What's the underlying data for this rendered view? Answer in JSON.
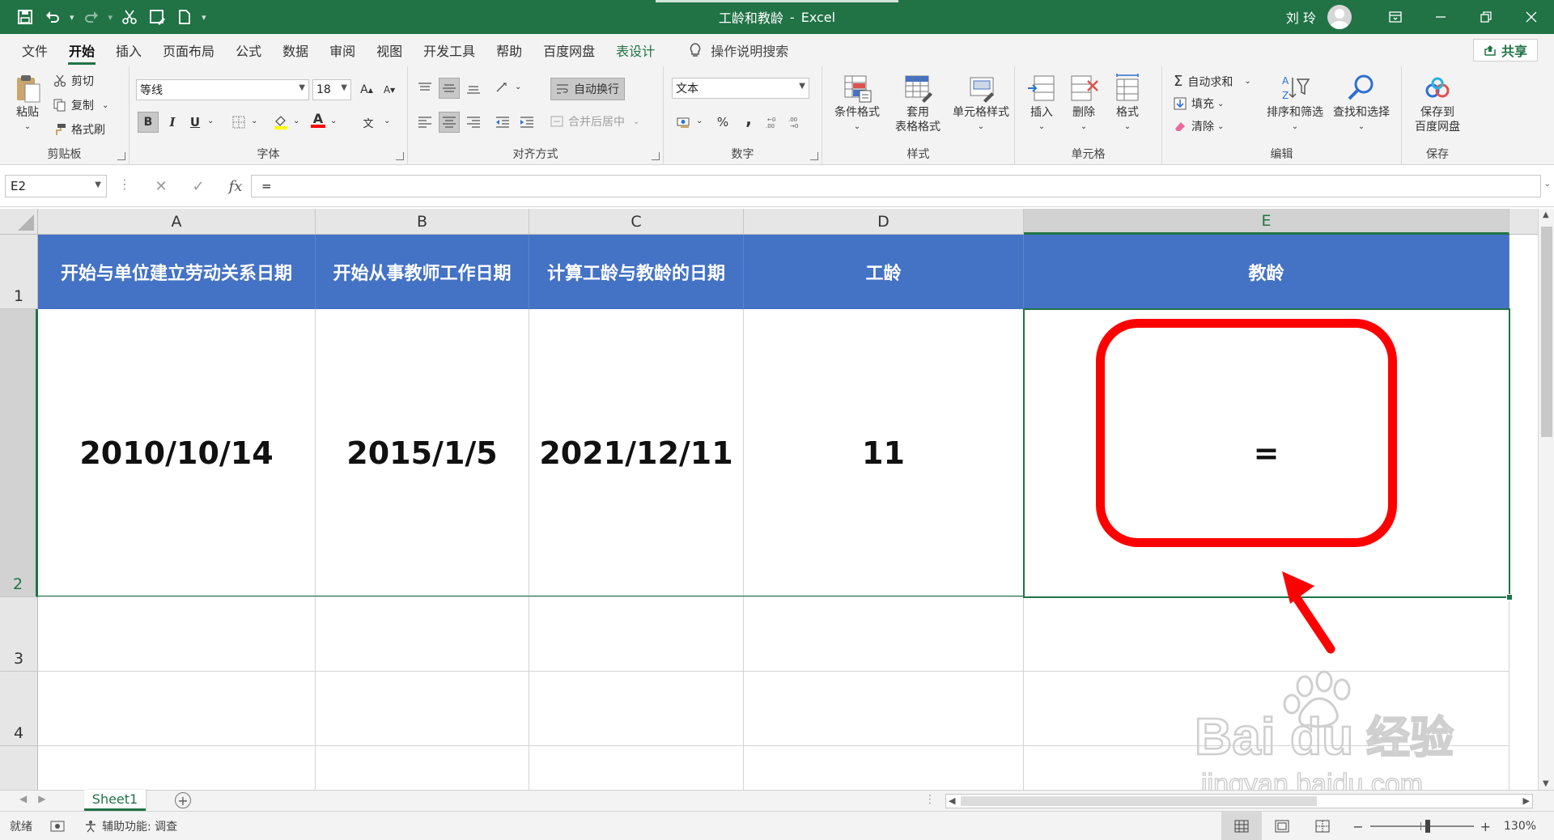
{
  "window": {
    "title": "工龄和教龄",
    "app": "Excel",
    "user": "刘 玲"
  },
  "tabs": [
    {
      "label": "文件"
    },
    {
      "label": "开始",
      "active": true
    },
    {
      "label": "插入"
    },
    {
      "label": "页面布局"
    },
    {
      "label": "公式"
    },
    {
      "label": "数据"
    },
    {
      "label": "审阅"
    },
    {
      "label": "视图"
    },
    {
      "label": "开发工具"
    },
    {
      "label": "帮助"
    },
    {
      "label": "百度网盘"
    },
    {
      "label": "表设计",
      "accent": true
    }
  ],
  "tell_me": "操作说明搜索",
  "share": "共享",
  "ribbon": {
    "clipboard": {
      "paste": "粘贴",
      "cut": "剪切",
      "copy": "复制",
      "format_painter": "格式刷",
      "label": "剪贴板"
    },
    "font": {
      "name": "等线",
      "size": "18",
      "label": "字体",
      "bold": "B",
      "italic": "I",
      "underline": "U",
      "grow": "A",
      "shrink": "A",
      "color_letter": "A",
      "phonetic": "文"
    },
    "alignment": {
      "wrap": "自动换行",
      "merge": "合并后居中",
      "label": "对齐方式"
    },
    "number": {
      "format": "文本",
      "percent": "%",
      "comma": ",",
      "label": "数字"
    },
    "styles": {
      "conditional": "条件格式",
      "table_format_1": "套用",
      "table_format_2": "表格格式",
      "cell_styles": "单元格样式",
      "label": "样式"
    },
    "cells": {
      "insert": "插入",
      "delete": "删除",
      "format": "格式",
      "label": "单元格"
    },
    "editing": {
      "autosum": "自动求和",
      "fill": "填充",
      "clear": "清除",
      "sort": "排序和筛选",
      "find": "查找和选择",
      "label": "编辑"
    },
    "save": {
      "line1": "保存到",
      "line2": "百度网盘",
      "label": "保存"
    }
  },
  "formula_bar": {
    "name_box": "E2",
    "fx": "fx",
    "content": "="
  },
  "columns": [
    "A",
    "B",
    "C",
    "D",
    "E"
  ],
  "rows": [
    "1",
    "2",
    "3",
    "4"
  ],
  "table": {
    "headers": [
      "开始与单位建立劳动关系日期",
      "开始从事教师工作日期",
      "计算工龄与教龄的日期",
      "工龄",
      "教龄"
    ],
    "row": [
      "2010/10/14",
      "2015/1/5",
      "2021/12/11",
      "11",
      "="
    ]
  },
  "sheet": {
    "name": "Sheet1"
  },
  "status": {
    "ready": "就绪",
    "accessibility": "辅助功能: 调查",
    "zoom": "130%"
  },
  "colors": {
    "excel_green": "#217346",
    "header_blue": "#4472c4",
    "annotation_red": "#ff0000"
  },
  "watermark": {
    "brand": "Bai",
    "brand2": "du",
    "cn": "经验",
    "url": "jingyan.baidu.com"
  }
}
